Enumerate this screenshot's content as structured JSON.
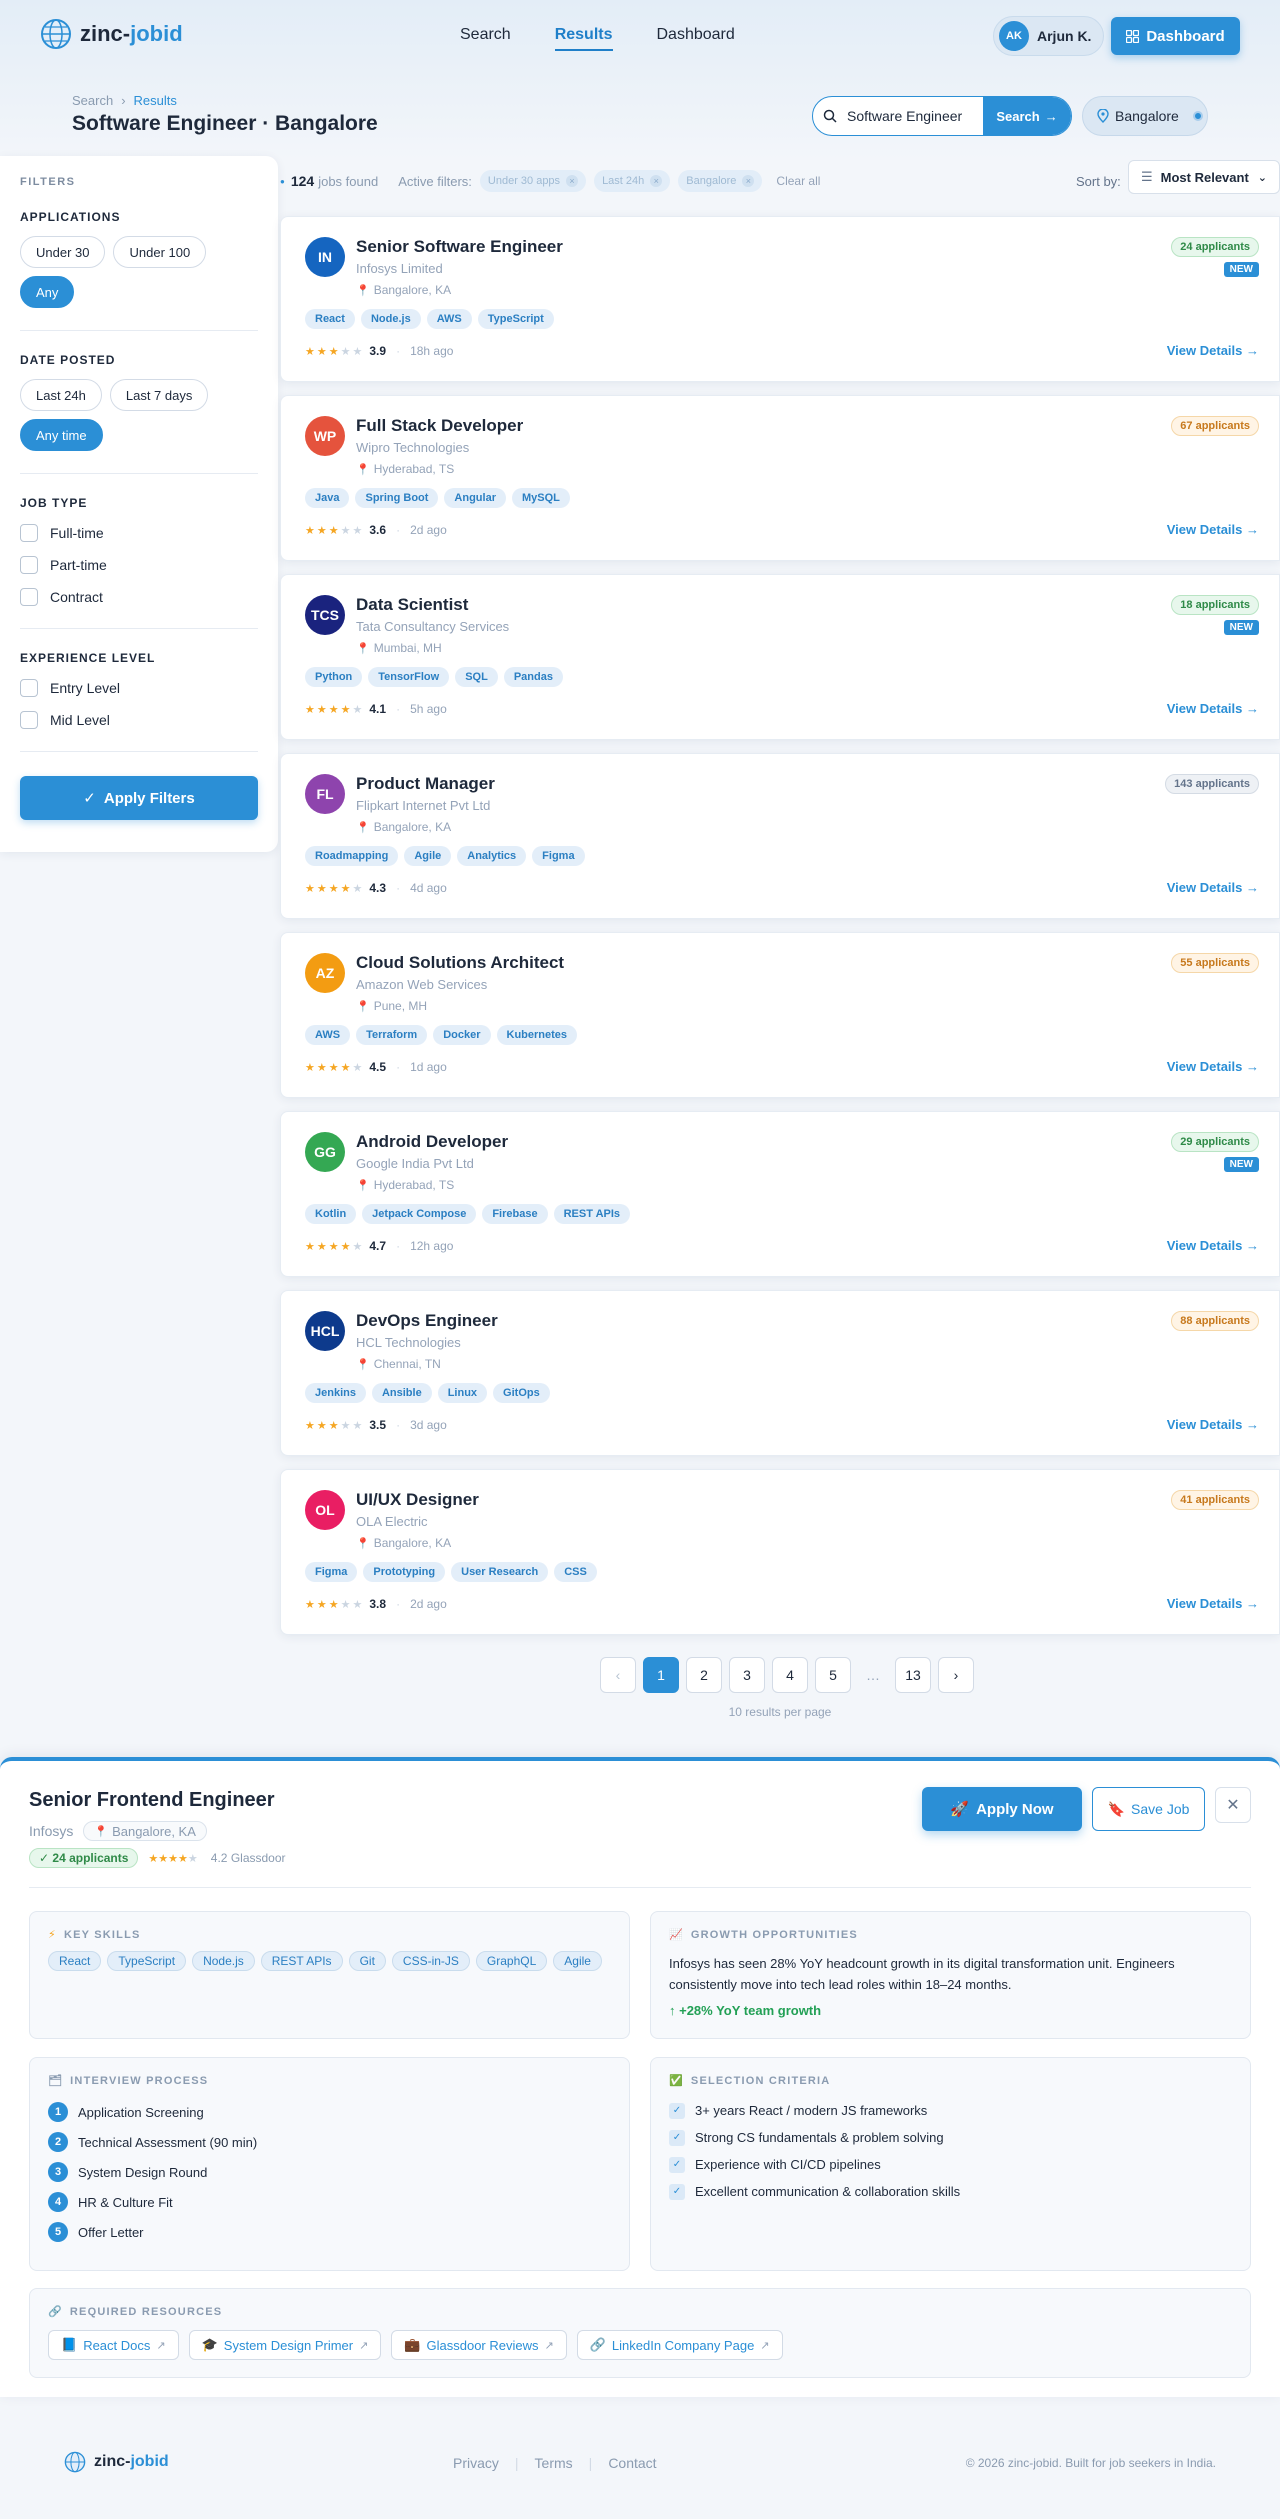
{
  "brand": {
    "name_main": "zinc-",
    "name_accent": "jobid"
  },
  "nav": {
    "items": [
      {
        "label": "Search"
      },
      {
        "label": "Results"
      },
      {
        "label": "Dashboard"
      }
    ],
    "active": "Results"
  },
  "user": {
    "initials": "AK",
    "name": "Arjun K."
  },
  "header": {
    "dashboard_label": "Dashboard"
  },
  "breadcrumb": {
    "root": "Search",
    "current": "Results"
  },
  "page_title": "Software Engineer · Bangalore",
  "search": {
    "value": "Software Engineer",
    "button_label": "Search",
    "location": "Bangalore"
  },
  "filters": {
    "heading": "FILTERS",
    "applications": {
      "label": "APPLICATIONS",
      "options": [
        "Under 30",
        "Under 100",
        "Any"
      ],
      "selected": "Any"
    },
    "date_posted": {
      "label": "DATE POSTED",
      "options": [
        "Last 24h",
        "Last 7 days",
        "Any time"
      ],
      "selected": "Any time"
    },
    "job_type": {
      "label": "JOB TYPE",
      "options": [
        "Full-time",
        "Part-time",
        "Contract"
      ]
    },
    "experience": {
      "label": "EXPERIENCE LEVEL",
      "options": [
        "Entry Level",
        "Mid Level"
      ]
    },
    "apply_label": "Apply Filters"
  },
  "results_bar": {
    "count": "124",
    "count_suffix": "jobs found",
    "active_label": "Active filters:",
    "chips": [
      "Under 30 apps",
      "Last 24h",
      "Bangalore"
    ],
    "clear_label": "Clear all",
    "sort_label": "Sort by:",
    "sort_value": "Most Relevant"
  },
  "jobs": [
    {
      "initials": "IN",
      "color": "#1565c0",
      "title": "Senior Software Engineer",
      "company": "Infosys Limited",
      "location": "Bangalore, KA",
      "tags": [
        "React",
        "Node.js",
        "AWS",
        "TypeScript"
      ],
      "rating": "3.9",
      "stars": 3,
      "ago": "18h ago",
      "applicants": "24 applicants",
      "badge": "green",
      "new": true
    },
    {
      "initials": "WP",
      "color": "#e5533d",
      "title": "Full Stack Developer",
      "company": "Wipro Technologies",
      "location": "Hyderabad, TS",
      "tags": [
        "Java",
        "Spring Boot",
        "Angular",
        "MySQL"
      ],
      "rating": "3.6",
      "stars": 3,
      "ago": "2d ago",
      "applicants": "67 applicants",
      "badge": "orange",
      "new": false
    },
    {
      "initials": "TCS",
      "color": "#1a237e",
      "title": "Data Scientist",
      "company": "Tata Consultancy Services",
      "location": "Mumbai, MH",
      "tags": [
        "Python",
        "TensorFlow",
        "SQL",
        "Pandas"
      ],
      "rating": "4.1",
      "stars": 4,
      "ago": "5h ago",
      "applicants": "18 applicants",
      "badge": "green",
      "new": true
    },
    {
      "initials": "FL",
      "color": "#8e44ad",
      "title": "Product Manager",
      "company": "Flipkart Internet Pvt Ltd",
      "location": "Bangalore, KA",
      "tags": [
        "Roadmapping",
        "Agile",
        "Analytics",
        "Figma"
      ],
      "rating": "4.3",
      "stars": 4,
      "ago": "4d ago",
      "applicants": "143 applicants",
      "badge": "gray",
      "new": false
    },
    {
      "initials": "AZ",
      "color": "#f39c12",
      "title": "Cloud Solutions Architect",
      "company": "Amazon Web Services",
      "location": "Pune, MH",
      "tags": [
        "AWS",
        "Terraform",
        "Docker",
        "Kubernetes"
      ],
      "rating": "4.5",
      "stars": 4,
      "ago": "1d ago",
      "applicants": "55 applicants",
      "badge": "orange",
      "new": false
    },
    {
      "initials": "GG",
      "color": "#34a853",
      "title": "Android Developer",
      "company": "Google India Pvt Ltd",
      "location": "Hyderabad, TS",
      "tags": [
        "Kotlin",
        "Jetpack Compose",
        "Firebase",
        "REST APIs"
      ],
      "rating": "4.7",
      "stars": 4,
      "ago": "12h ago",
      "applicants": "29 applicants",
      "badge": "green",
      "new": true
    },
    {
      "initials": "HCL",
      "color": "#0d3a8c",
      "title": "DevOps Engineer",
      "company": "HCL Technologies",
      "location": "Chennai, TN",
      "tags": [
        "Jenkins",
        "Ansible",
        "Linux",
        "GitOps"
      ],
      "rating": "3.5",
      "stars": 3,
      "ago": "3d ago",
      "applicants": "88 applicants",
      "badge": "orange",
      "new": false
    },
    {
      "initials": "OL",
      "color": "#e91e63",
      "title": "UI/UX Designer",
      "company": "OLA Electric",
      "location": "Bangalore, KA",
      "tags": [
        "Figma",
        "Prototyping",
        "User Research",
        "CSS"
      ],
      "rating": "3.8",
      "stars": 3,
      "ago": "2d ago",
      "applicants": "41 applicants",
      "badge": "orange",
      "new": false
    }
  ],
  "job_labels": {
    "view_details": "View Details →",
    "new_badge": "NEW"
  },
  "pagination": {
    "pages": [
      "1",
      "2",
      "3",
      "4",
      "5",
      "…",
      "13"
    ],
    "current": "1",
    "per_page": "10 results per page"
  },
  "detail": {
    "title": "Senior Frontend Engineer",
    "company": "Infosys",
    "location": "Bangalore, KA",
    "applicants": "✓ 24 applicants",
    "stars": 4,
    "glassdoor": "4.2 Glassdoor",
    "apply_label": "Apply Now",
    "save_label": "Save Job",
    "skills_heading": "KEY SKILLS",
    "skills": [
      "React",
      "TypeScript",
      "Node.js",
      "REST APIs",
      "Git",
      "CSS-in-JS",
      "GraphQL",
      "Agile"
    ],
    "growth_heading": "GROWTH OPPORTUNITIES",
    "growth_text": "Infosys has seen 28% YoY headcount growth in its digital transformation unit. Engineers consistently move into tech lead roles within 18–24 months.",
    "growth_stat": "↑ +28% YoY team growth",
    "interview_heading": "INTERVIEW PROCESS",
    "interview_steps": [
      "Application Screening",
      "Technical Assessment (90 min)",
      "System Design Round",
      "HR & Culture Fit",
      "Offer Letter"
    ],
    "criteria_heading": "SELECTION CRITERIA",
    "criteria": [
      "3+ years React / modern JS frameworks",
      "Strong CS fundamentals & problem solving",
      "Experience with CI/CD pipelines",
      "Excellent communication & collaboration skills"
    ],
    "resources_heading": "REQUIRED RESOURCES",
    "resources": [
      {
        "icon": "📘",
        "label": "React Docs"
      },
      {
        "icon": "🎓",
        "label": "System Design Primer"
      },
      {
        "icon": "💼",
        "label": "Glassdoor Reviews"
      },
      {
        "icon": "🔗",
        "label": "LinkedIn Company Page"
      }
    ]
  },
  "footer": {
    "links": [
      "Privacy",
      "Terms",
      "Contact"
    ],
    "copyright": "© 2026 zinc-jobid. Built for job seekers in India."
  },
  "colors": {
    "accent": "#2b8fd6",
    "green": "#22a055",
    "star": "#f5a623"
  }
}
